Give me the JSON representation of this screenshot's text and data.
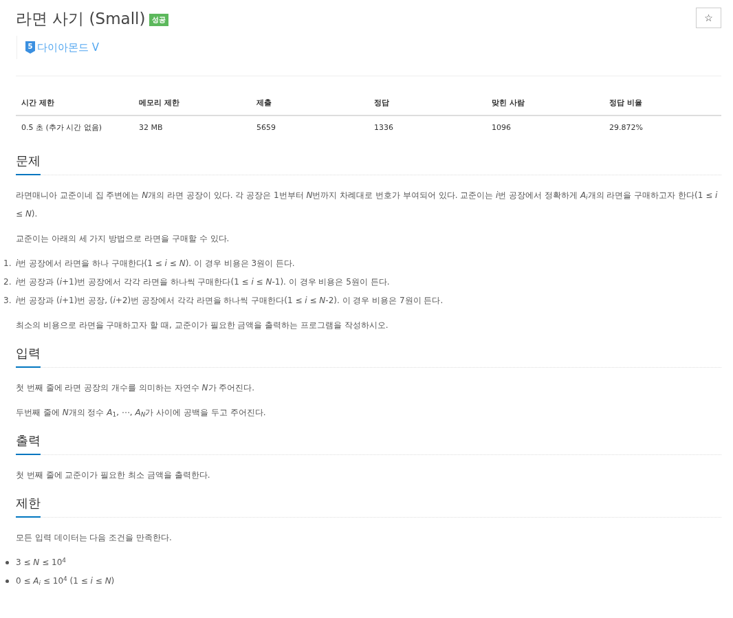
{
  "title": "라면 사기 (Small)",
  "result_badge": "성공",
  "tier": {
    "icon_number": "5",
    "label": "다이아몬드 V"
  },
  "star_button": {
    "icon": "☆"
  },
  "stats_table": {
    "columns": [
      "시간 제한",
      "메모리 제한",
      "제출",
      "정답",
      "맞힌 사람",
      "정답 비율"
    ],
    "rows": [
      [
        "0.5 초 (추가 시간 없음)",
        "32 MB",
        "5659",
        "1336",
        "1096",
        "29.872%"
      ]
    ]
  },
  "sections": [
    {
      "heading": "문제",
      "blocks": [
        {
          "kind": "paragraph",
          "runs": [
            "라면매니아 교준이네 집 주변에는 ",
            {
              "var": "N"
            },
            "개의 라면 공장이 있다. 각 공장은 1번부터 ",
            {
              "var": "N"
            },
            "번까지 차례대로 번호가 부여되어 있다. 교준이는 ",
            {
              "var": "i"
            },
            "번 공장에서 정확하게 ",
            {
              "var": "A",
              "sub": "i",
              "sub_italic": true
            },
            "개의 라면을 구매하고자 한다(1 ≤ ",
            {
              "var": "i"
            },
            " ≤ ",
            {
              "var": "N"
            },
            ")."
          ]
        },
        {
          "kind": "paragraph",
          "runs": [
            "교준이는 아래의 세 가지 방법으로 라면을 구매할 수 있다."
          ]
        },
        {
          "kind": "numbered",
          "items": [
            {
              "number": "1.",
              "runs": [
                {
                  "var": "i"
                },
                "번 공장에서 라면을 하나 구매한다(1 ≤ ",
                {
                  "var": "i"
                },
                " ≤ ",
                {
                  "var": "N"
                },
                "). 이 경우 비용은 3원이 든다."
              ]
            },
            {
              "number": "2.",
              "runs": [
                {
                  "var": "i"
                },
                "번 공장과 (",
                {
                  "var": "i"
                },
                "+1)번 공장에서 각각 라면을 하나씩 구매한다(1 ≤ ",
                {
                  "var": "i"
                },
                " ≤ ",
                {
                  "var": "N"
                },
                "-1). 이 경우 비용은 5원이 든다."
              ]
            },
            {
              "number": "3.",
              "runs": [
                {
                  "var": "i"
                },
                "번 공장과 (",
                {
                  "var": "i"
                },
                "+1)번 공장, (",
                {
                  "var": "i"
                },
                "+2)번 공장에서 각각 라면을 하나씩 구매한다(1 ≤ ",
                {
                  "var": "i"
                },
                " ≤ ",
                {
                  "var": "N"
                },
                "-2). 이 경우 비용은 7원이 든다."
              ]
            }
          ]
        },
        {
          "kind": "paragraph",
          "runs": [
            "최소의 비용으로 라면을 구매하고자 할 때, 교준이가 필요한 금액을 출력하는 프로그램을 작성하시오."
          ]
        }
      ]
    },
    {
      "heading": "입력",
      "blocks": [
        {
          "kind": "paragraph",
          "runs": [
            "첫 번째 줄에 라면 공장의 개수를 의미하는 자연수 ",
            {
              "var": "N"
            },
            "가 주어진다."
          ]
        },
        {
          "kind": "paragraph",
          "runs": [
            "두번째 줄에 ",
            {
              "var": "N"
            },
            "개의 정수 ",
            {
              "var": "A",
              "sub": "1",
              "sub_italic": false
            },
            ", ⋯, ",
            {
              "var": "A",
              "sub": "N",
              "sub_italic": true
            },
            "가 사이에 공백을 두고 주어진다."
          ]
        }
      ]
    },
    {
      "heading": "출력",
      "blocks": [
        {
          "kind": "paragraph",
          "runs": [
            "첫 번째 줄에 교준이가 필요한 최소 금액을 출력한다."
          ]
        }
      ]
    },
    {
      "heading": "제한",
      "blocks": [
        {
          "kind": "paragraph",
          "runs": [
            "모든 입력 데이터는 다음 조건을 만족한다."
          ]
        },
        {
          "kind": "bullets",
          "items": [
            [
              "3 ≤ ",
              {
                "var": "N"
              },
              " ≤ ",
              {
                "num": "10",
                "sup": "4"
              }
            ],
            [
              "0 ≤ ",
              {
                "var": "A",
                "sub": "i",
                "sub_italic": true
              },
              " ≤ ",
              {
                "num": "10",
                "sup": "4"
              },
              " (1 ≤ ",
              {
                "var": "i"
              },
              " ≤ ",
              {
                "var": "N"
              },
              ")"
            ]
          ]
        }
      ]
    }
  ]
}
